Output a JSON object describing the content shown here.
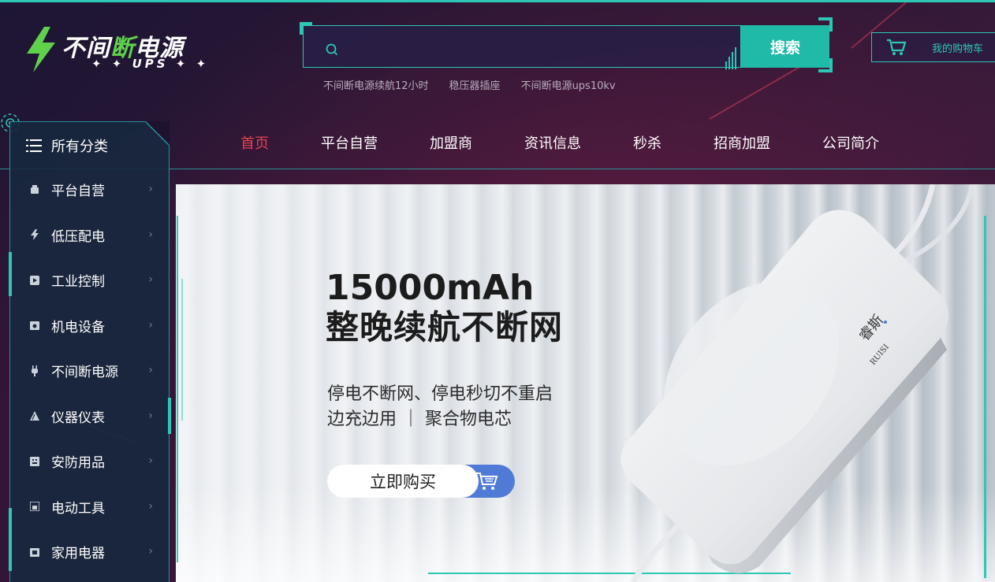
{
  "logo": {
    "title_part1": "不间",
    "title_highlight": "断",
    "title_part2": "电源",
    "subtitle": "✦ ✦ UPS ✦ ✦"
  },
  "search": {
    "placeholder": "",
    "button_label": "搜索",
    "hot_links": [
      "不间断电源续航12小时",
      "稳压器插座",
      "不间断电源ups10kv"
    ]
  },
  "cart": {
    "label": "我的购物车"
  },
  "nav": {
    "items": [
      {
        "label": "首页",
        "active": true
      },
      {
        "label": "平台自营",
        "active": false
      },
      {
        "label": "加盟商",
        "active": false
      },
      {
        "label": "资讯信息",
        "active": false
      },
      {
        "label": "秒杀",
        "active": false
      },
      {
        "label": "招商加盟",
        "active": false
      },
      {
        "label": "公司简介",
        "active": false
      }
    ]
  },
  "categories": {
    "header": "所有分类",
    "items": [
      {
        "label": "平台自营",
        "icon": "shop-icon"
      },
      {
        "label": "低压配电",
        "icon": "lightning-icon"
      },
      {
        "label": "工业控制",
        "icon": "control-icon"
      },
      {
        "label": "机电设备",
        "icon": "motor-icon"
      },
      {
        "label": "不间断电源",
        "icon": "plug-icon"
      },
      {
        "label": "仪器仪表",
        "icon": "meter-icon"
      },
      {
        "label": "安防用品",
        "icon": "shield-icon"
      },
      {
        "label": "电动工具",
        "icon": "tool-icon"
      },
      {
        "label": "家用电器",
        "icon": "appliance-icon"
      }
    ],
    "arrow": "›"
  },
  "banner": {
    "headline1": "15000mAh",
    "headline2": "整晚续航不断网",
    "line1": "停电不断网、停电秒切不重启",
    "line2": "边充边用 ｜ 聚合物电芯",
    "buy_label": "立即购买",
    "product_brand": "睿斯",
    "product_brand_en": "RUISI"
  },
  "colors": {
    "accent": "#2dc7b5",
    "nav_active": "#e8424f",
    "logo_green": "#5fd14b",
    "buy_blue": "#4f7bd6"
  }
}
